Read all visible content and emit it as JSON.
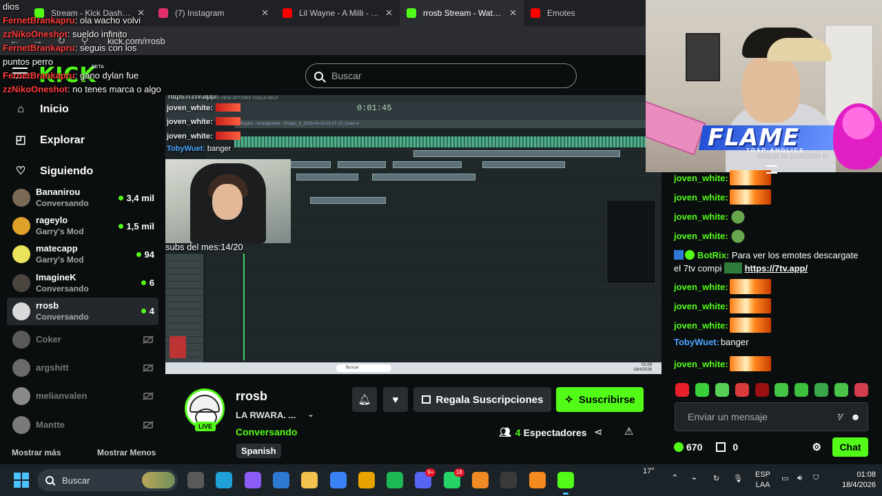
{
  "browser": {
    "tabs": [
      {
        "title": "Stream - Kick Dashboard",
        "color": "#53fc18",
        "active": false
      },
      {
        "title": "(7) Instagram",
        "color": "#e1306c",
        "active": false
      },
      {
        "title": "Lil Wayne - A Milli - You",
        "color": "#ff0000",
        "active": false
      },
      {
        "title": "rrosb Stream - Watch Live o",
        "color": "#53fc18",
        "active": true
      },
      {
        "title": "Emotes",
        "color": "#ff0000",
        "active": false
      }
    ],
    "url": "kick.com/rrosb",
    "close_glyph": "✕"
  },
  "overlay_chat": [
    {
      "user": "",
      "text": "dios",
      "color": "#ffffff"
    },
    {
      "user": "FernetBrankapru",
      "text": ": ola wacho volvi",
      "color": "#ff3b3b"
    },
    {
      "user": "zzNikoOneshot",
      "text": ": sueldo infinito",
      "color": "#ff3b3b"
    },
    {
      "user": "FernetBrankapru",
      "text": ": seguis con los puntos perro",
      "color": "#ff3b3b"
    },
    {
      "user": "FernetBrankapru",
      "text": ": gano dylan fue",
      "color": "#ff3b3b"
    },
    {
      "user": "zzNikoOneshot",
      "text": ": no tenes marca o algo",
      "color": "#ff3b3b"
    }
  ],
  "header": {
    "logo": "KICK",
    "beta": "BETA",
    "search_placeholder": "Buscar"
  },
  "sidebar": {
    "nav": [
      {
        "label": "Inicio",
        "icon": "home-icon",
        "glyph": "⌂"
      },
      {
        "label": "Explorar",
        "icon": "compass-icon",
        "glyph": "◰"
      },
      {
        "label": "Siguiendo",
        "icon": "heart-icon",
        "glyph": "♡"
      }
    ],
    "following": [
      {
        "name": "Bananirou",
        "category": "Conversando",
        "viewers": "3,4 mil",
        "online": true,
        "avatar": "#7a6a55"
      },
      {
        "name": "rageylo",
        "category": "Garry's Mod",
        "viewers": "1,5 mil",
        "online": true,
        "avatar": "#e0a12a"
      },
      {
        "name": "matecapp",
        "category": "Garry's Mod",
        "viewers": "94",
        "online": true,
        "avatar": "#e9e25a"
      },
      {
        "name": "ImagineK",
        "category": "Conversando",
        "viewers": "6",
        "online": true,
        "avatar": "#4b4540"
      },
      {
        "name": "rrosb",
        "category": "Conversando",
        "viewers": "4",
        "online": true,
        "avatar": "#d9d9d9",
        "active": true
      },
      {
        "name": "Coker",
        "category": "",
        "viewers": "",
        "online": false,
        "avatar": "#5a5a5a"
      },
      {
        "name": "argshitt",
        "category": "",
        "viewers": "",
        "online": false,
        "avatar": "#6a6a6a"
      },
      {
        "name": "melianvalen",
        "category": "",
        "viewers": "",
        "online": false,
        "avatar": "#8a8a8a"
      },
      {
        "name": "Mantte",
        "category": "",
        "viewers": "",
        "online": false,
        "avatar": "#7a7a7a"
      }
    ],
    "show_more": "Mostrar más",
    "show_less": "Mostrar Menos"
  },
  "player": {
    "daw_time": "0:01:45",
    "daw_title": "Playlist - Arrangement - Project_6_2026-04-18-01-07-23_Insert 4",
    "daw_menu": "FILE EDIT ADD PATTERNS VIEW OPTIONS TOOLS HELP",
    "overlay_lines": [
      {
        "user": "joven_white:",
        "text": ""
      },
      {
        "user": "joven_white:",
        "text": ""
      },
      {
        "user": "joven_white:",
        "text": ""
      },
      {
        "user": "TobyWuet:",
        "text": " banger"
      }
    ],
    "top_overlay_text": "https://7tv.app/",
    "subs_text": "subs del mes:14/20",
    "mini_search": "Buscar",
    "mini_time": "01:08",
    "mini_date": "18/4/2026"
  },
  "webcam": {
    "flame_title": "FLAME",
    "flame_sub": "TRAP-AHOLICS",
    "top_text": "tomar la posicion o"
  },
  "chat": {
    "messages": [
      {
        "user": "joven_white:",
        "emote": "fire",
        "text": ""
      },
      {
        "user": "joven_white:",
        "emote": "fire",
        "text": ""
      },
      {
        "user": "joven_white:",
        "emote": "pepe",
        "text": ""
      },
      {
        "user": "joven_white:",
        "emote": "pepe",
        "text": ""
      },
      {
        "user": "joven_white:",
        "emote": "fire",
        "text": ""
      },
      {
        "user": "joven_white:",
        "emote": "fire",
        "text": ""
      },
      {
        "user": "joven_white:",
        "emote": "fire",
        "text": ""
      },
      {
        "user": "TobyWuet:",
        "emote": "",
        "text": "banger"
      },
      {
        "user": "joven_white:",
        "emote": "fire",
        "text": ""
      }
    ],
    "bot": {
      "user": "BotRix:",
      "text": " Para ver los emotes descargate el 7tv compi ",
      "link": "https://7tv.app/"
    },
    "emote_colors": [
      "#e8202a",
      "#3bd13b",
      "#58d058",
      "#d93a3a",
      "#9b1010",
      "#45c545",
      "#3fc03f",
      "#3aa84a",
      "#49c449",
      "#d33e4e"
    ],
    "input_placeholder": "Enviar un mensaje",
    "points": "670",
    "gifts": "0",
    "chat_button": "Chat"
  },
  "stream": {
    "channel": "rrosb",
    "title": "LA RWARA. ...",
    "category": "Conversando",
    "tag": "Spanish",
    "live": "LIVE",
    "gift_button": "Regala Suscripciones",
    "subscribe_button": "Suscribirse",
    "viewers_count": "4",
    "viewers_label": "Espectadores"
  },
  "taskbar": {
    "search": "Buscar",
    "weather": "17°",
    "lang1": "ESP",
    "lang2": "LAA",
    "time": "01:08",
    "date": "18/4/2026",
    "apps": [
      {
        "name": "file-explorer-app",
        "color": "#5a5a5a"
      },
      {
        "name": "edge-app",
        "color": "#1fa0d6"
      },
      {
        "name": "copilot-app",
        "color": "#8a5cf5"
      },
      {
        "name": "mail-app",
        "color": "#2d78d2"
      },
      {
        "name": "folder-app",
        "color": "#f2c14e"
      },
      {
        "name": "store-app",
        "color": "#3b82f6"
      },
      {
        "name": "chrome-app",
        "color": "#e8a300",
        "badge": ""
      },
      {
        "name": "spotify-app",
        "color": "#1db954"
      },
      {
        "name": "discord-app",
        "color": "#5865f2",
        "badge": "9+"
      },
      {
        "name": "whatsapp-app",
        "color": "#25d366",
        "badge": "18"
      },
      {
        "name": "cloud-app",
        "color": "#f08a24"
      },
      {
        "name": "obs-app",
        "color": "#3a3a3a"
      },
      {
        "name": "fl-studio-app",
        "color": "#f58a1f"
      },
      {
        "name": "kick-app",
        "color": "#53fc18",
        "active": true
      }
    ]
  }
}
